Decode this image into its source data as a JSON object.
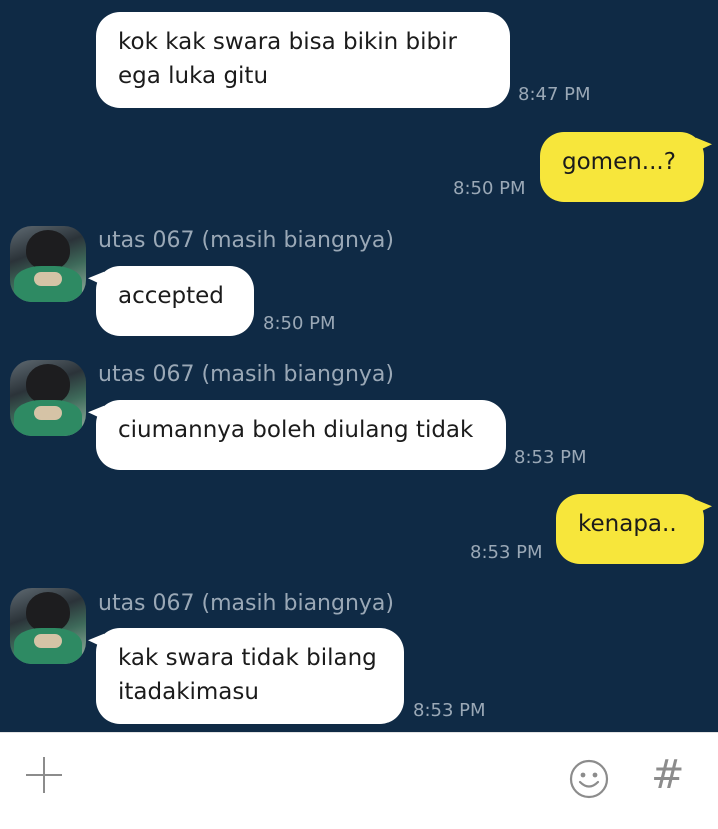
{
  "messages": [
    {
      "text": "kok kak swara bisa bikin bibir\nega luka gitu",
      "time": "8:47 PM"
    },
    {
      "text": "gomen...?",
      "time": "8:50 PM"
    },
    {
      "sender": "utas 067 (masih biangnya)",
      "text": "accepted",
      "time": "8:50 PM"
    },
    {
      "sender": "utas 067 (masih biangnya)",
      "text": "ciumannya boleh diulang tidak",
      "time": "8:53 PM"
    },
    {
      "text": "kenapa..",
      "time": "8:53 PM"
    },
    {
      "sender": "utas 067 (masih biangnya)",
      "text": "kak swara tidak bilang\nitadakimasu",
      "time": "8:53 PM"
    }
  ],
  "composer": {
    "left_icon": "plus-icon",
    "emoji_icon": "smile-icon",
    "hashtag_symbol": "#"
  },
  "colors": {
    "background": "#0f2a45",
    "incoming_bubble": "#ffffff",
    "outgoing_bubble": "#f7e63b",
    "meta_text": "#9aa8b6"
  }
}
